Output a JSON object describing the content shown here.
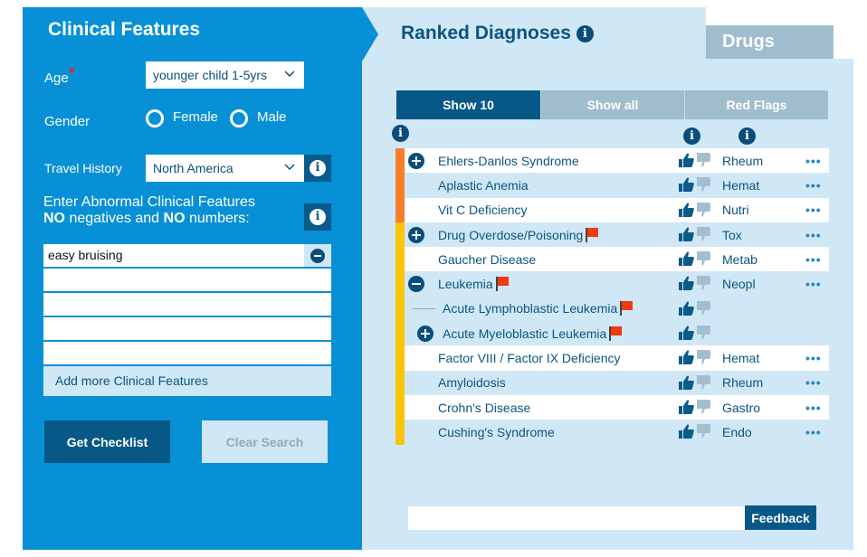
{
  "colors": {
    "left_panel_bg": "#0890d6",
    "right_panel_bg": "#d0e7f5",
    "primary_dark": "#075887",
    "tab_inactive": "#a0bdce",
    "rank_orange": "#f97e2a",
    "rank_yellow": "#fcc507",
    "flag_red": "#f03a0c",
    "required_star": "#e0261c"
  },
  "clinical_features": {
    "title": "Clinical Features",
    "age": {
      "label": "Age",
      "required_mark": "*",
      "value": "younger child 1-5yrs"
    },
    "gender": {
      "label": "Gender",
      "options": [
        "Female",
        "Male"
      ],
      "selected": null
    },
    "travel": {
      "label": "Travel History",
      "value": "North America"
    },
    "instructions": {
      "line1": "Enter Abnormal Clinical Features",
      "no1": "NO",
      "mid": " negatives and ",
      "no2": "NO",
      "end": " numbers:"
    },
    "features": [
      "easy bruising",
      "",
      "",
      "",
      ""
    ],
    "add_more_label": "Add more Clinical Features",
    "get_checklist_label": "Get Checklist",
    "clear_search_label": "Clear Search"
  },
  "ranked": {
    "title": "Ranked Diagnoses",
    "drugs_tab": "Drugs",
    "info_glyph": "i",
    "tabs": [
      {
        "label": "Show 10",
        "active": true
      },
      {
        "label": "Show all",
        "active": false
      },
      {
        "label": "Red Flags",
        "active": false
      }
    ],
    "rows": [
      {
        "name": "Ehlers-Danlos Syndrome",
        "toggle": "plus",
        "flag": false,
        "specialty": "Rheum",
        "more": "•••",
        "rank": "orange",
        "level": 0
      },
      {
        "name": "Aplastic Anemia",
        "toggle": "",
        "flag": false,
        "specialty": "Hemat",
        "more": "•••",
        "rank": "orange",
        "level": 0
      },
      {
        "name": "Vit C Deficiency",
        "toggle": "",
        "flag": false,
        "specialty": "Nutri",
        "more": "•••",
        "rank": "orange",
        "level": 0
      },
      {
        "name": "Drug Overdose/Poisoning",
        "toggle": "plus",
        "flag": true,
        "specialty": "Tox",
        "more": "•••",
        "rank": "yellow",
        "level": 0
      },
      {
        "name": "Gaucher Disease",
        "toggle": "",
        "flag": false,
        "specialty": "Metab",
        "more": "•••",
        "rank": "yellow",
        "level": 0
      },
      {
        "name": "Leukemia",
        "toggle": "minus",
        "flag": true,
        "specialty": "Neopl",
        "more": "•••",
        "rank": "yellow",
        "level": 0
      },
      {
        "name": "Acute Lymphoblastic Leukemia",
        "toggle": "dash",
        "flag": true,
        "specialty": "",
        "more": "",
        "rank": "yellow",
        "level": 1
      },
      {
        "name": "Acute Myeloblastic Leukemia",
        "toggle": "plus",
        "flag": true,
        "specialty": "",
        "more": "",
        "rank": "yellow",
        "level": 1
      },
      {
        "name": "Factor VIII / Factor IX Deficiency",
        "toggle": "",
        "flag": false,
        "specialty": "Hemat",
        "more": "•••",
        "rank": "yellow",
        "level": 0
      },
      {
        "name": "Amyloidosis",
        "toggle": "",
        "flag": false,
        "specialty": "Rheum",
        "more": "•••",
        "rank": "yellow",
        "level": 0
      },
      {
        "name": "Crohn's Disease",
        "toggle": "",
        "flag": false,
        "specialty": "Gastro",
        "more": "•••",
        "rank": "yellow",
        "level": 0
      },
      {
        "name": "Cushing's Syndrome",
        "toggle": "",
        "flag": false,
        "specialty": "Endo",
        "more": "•••",
        "rank": "yellow",
        "level": 0
      }
    ],
    "feedback": {
      "value": "",
      "button_label": "Feedback"
    }
  }
}
